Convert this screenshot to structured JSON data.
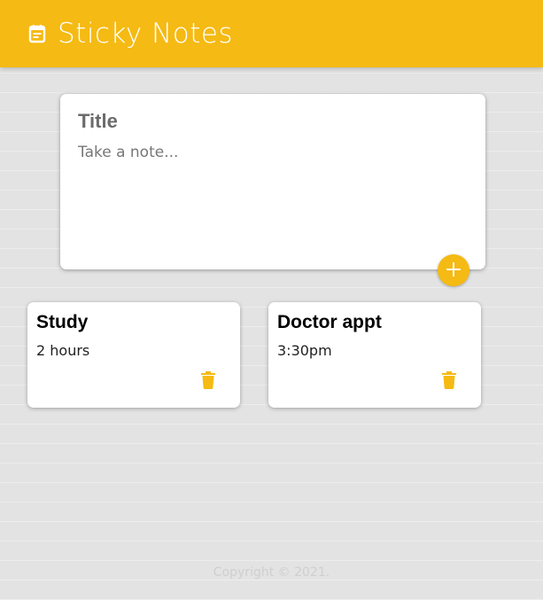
{
  "header": {
    "title": "Sticky Notes",
    "icon": "notes-icon",
    "background_color": "#f5ba13"
  },
  "create_form": {
    "title_placeholder": "Title",
    "content_placeholder": "Take a note...",
    "add_icon": "plus-icon"
  },
  "notes": [
    {
      "title": "Study",
      "content": "2 hours",
      "delete_icon": "trash-icon"
    },
    {
      "title": "Doctor appt",
      "content": "3:30pm",
      "delete_icon": "trash-icon"
    }
  ],
  "footer": {
    "text": "Copyright © 2021."
  },
  "colors": {
    "accent": "#f5ba13",
    "card": "#ffffff",
    "background": "#e3e3e3"
  }
}
